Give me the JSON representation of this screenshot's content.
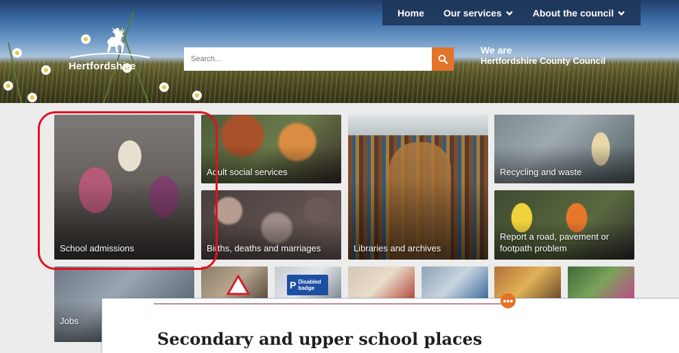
{
  "header": {
    "logo_text": "Hertfordshire",
    "nav": [
      {
        "label": "Home",
        "has_dropdown": false
      },
      {
        "label": "Our services",
        "has_dropdown": true
      },
      {
        "label": "About the council",
        "has_dropdown": true
      }
    ],
    "search": {
      "placeholder": "Search..."
    },
    "tagline": {
      "line1": "We are",
      "line2": "Hertfordshire County Council"
    }
  },
  "tiles": {
    "school": "School admissions",
    "adult": "Adult social services",
    "births": "Births, deaths and marriages",
    "libraries": "Libraries and archives",
    "recycling": "Recycling and waste",
    "road": "Report a road, pavement or footpath problem",
    "jobs": "Jobs"
  },
  "partial_tiles": {
    "disabled_badge": "Disabled badge"
  },
  "popup": {
    "title": "Secondary and upper school places",
    "menu_icon": "ellipsis-icon"
  },
  "colors": {
    "accent_orange": "#e3722a",
    "nav_bg": "#1e3458",
    "highlight_red": "#e3101e"
  }
}
